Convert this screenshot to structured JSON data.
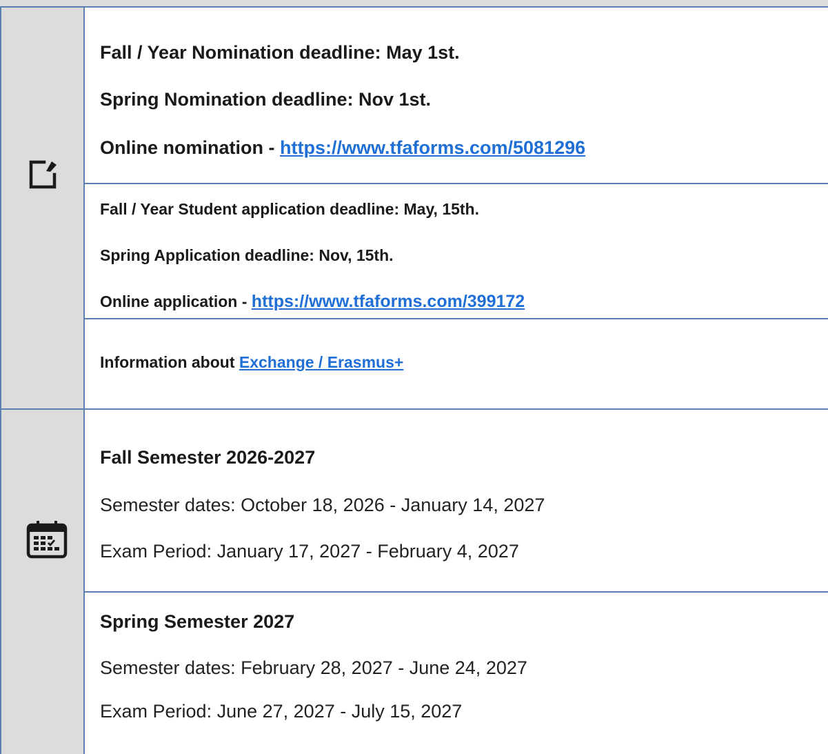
{
  "icons": {
    "edit": "edit-icon",
    "calendar": "calendar-icon"
  },
  "colors": {
    "link": "#1f6fd6",
    "border": "#5b7fb0",
    "icon_cell_bg": "#dcdcdc"
  },
  "nominations": {
    "fall_deadline": "Fall / Year Nomination deadline: May 1st.",
    "spring_deadline": "Spring Nomination deadline: Nov 1st.",
    "online_label": "Online nomination - ",
    "online_link": "https://www.tfaforms.com/5081296"
  },
  "applications": {
    "fall_deadline": "Fall / Year Student application deadline: May, 15th.",
    "spring_deadline": "Spring Application deadline: Nov, 15th.",
    "online_label": "Online application - ",
    "online_link": "https://www.tfaforms.com/399172"
  },
  "info": {
    "label": "Information about ",
    "link": "Exchange / Erasmus+"
  },
  "fall_semester": {
    "title": "Fall Semester 2026-2027",
    "dates": "Semester dates: October 18, 2026 - January 14, 2027",
    "exams": "Exam Period: January 17, 2027 - February 4, 2027"
  },
  "spring_semester": {
    "title": "Spring Semester 2027",
    "dates": "Semester dates: February 28, 2027 - June 24, 2027",
    "exams": "Exam Period: June 27, 2027 - July 15, 2027"
  }
}
